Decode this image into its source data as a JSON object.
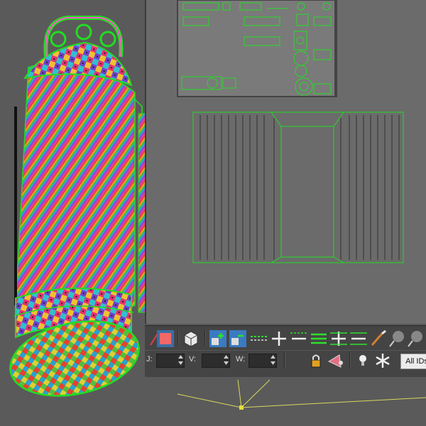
{
  "viewport": {
    "background": "#5a5a5a"
  },
  "uv_editor": {
    "panel_color": "#6b6b6b",
    "wire_color": "#22dd22"
  },
  "toolbar": {
    "spinners": [
      {
        "label": "J:",
        "value": ""
      },
      {
        "label": "V:",
        "value": ""
      },
      {
        "label": "W:",
        "value": ""
      }
    ],
    "id_filter_label": "All IDs"
  },
  "icons": [
    "paint-brush-icon",
    "checker-swatch-icon",
    "cube-map-icon",
    "select-add-icon",
    "select-subtract-icon",
    "ring-icon",
    "plus-icon",
    "minus-icon",
    "loop-icon",
    "grow-icon",
    "shrink-icon",
    "brush-icon",
    "sphere-pin-icon",
    "lock-icon",
    "paint-select-icon",
    "light-icon",
    "snowflake-icon"
  ]
}
